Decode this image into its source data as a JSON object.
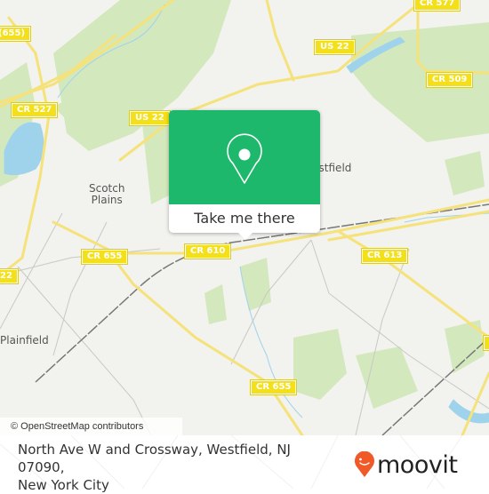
{
  "map": {
    "road_shields": [
      {
        "label": "CR 577"
      },
      {
        "label": "(655)"
      },
      {
        "label": "US 22"
      },
      {
        "label": "CR 509"
      },
      {
        "label": "CR 527"
      },
      {
        "label": "US 22"
      },
      {
        "label": "22"
      },
      {
        "label": "CR 655"
      },
      {
        "label": "CR 610"
      },
      {
        "label": "CR 613"
      },
      {
        "label": "CR 655"
      }
    ],
    "places": [
      {
        "label": "Scotch\nPlains"
      },
      {
        "label": "Westfield"
      },
      {
        "label": "Plainfield"
      }
    ],
    "attribution": "© OpenStreetMap contributors"
  },
  "popup": {
    "icon": "map-pin-icon",
    "button_label": "Take me there",
    "accent_color": "#1db86b"
  },
  "footer": {
    "address_line1": "North Ave W and Crossway, Westfield, NJ 07090,",
    "address_line2": "New York City",
    "logo_text": "moovit",
    "logo_color": "#f05a28"
  }
}
